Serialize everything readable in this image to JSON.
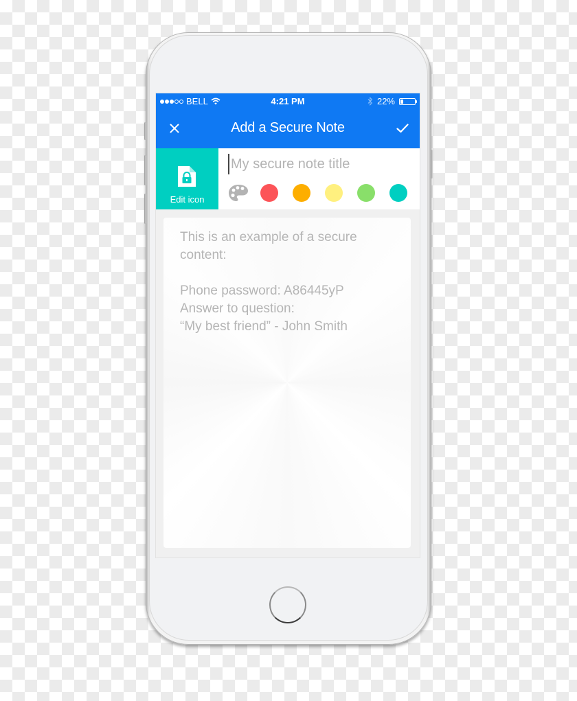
{
  "status_bar": {
    "signal_full": 3,
    "signal_total": 5,
    "carrier": "BELL",
    "wifi_icon": "wifi-icon",
    "time": "4:21 PM",
    "bluetooth_icon": "bluetooth-icon",
    "battery_percent": "22%",
    "battery_level": 0.22
  },
  "nav": {
    "close_icon": "close-icon",
    "title": "Add a Secure Note",
    "confirm_icon": "checkmark-icon"
  },
  "note_header": {
    "edit_icon_label": "Edit icon",
    "tile_icon": "locked-file-icon",
    "title_value": "",
    "title_placeholder": "My secure note title",
    "palette_icon": "palette-icon",
    "colors": [
      {
        "name": "red",
        "hex": "#fc5458"
      },
      {
        "name": "orange",
        "hex": "#fdae00"
      },
      {
        "name": "yellow",
        "hex": "#fff07f"
      },
      {
        "name": "green",
        "hex": "#89df6a"
      },
      {
        "name": "teal",
        "hex": "#00cfc1"
      }
    ]
  },
  "content": {
    "text": "This is an example of a secure\ncontent:\n\nPhone password: A86445yP\nAnswer to question:\n“My best friend” - John Smith"
  },
  "theme": {
    "primary": "#0f79f3",
    "accent": "#00cfc1"
  }
}
